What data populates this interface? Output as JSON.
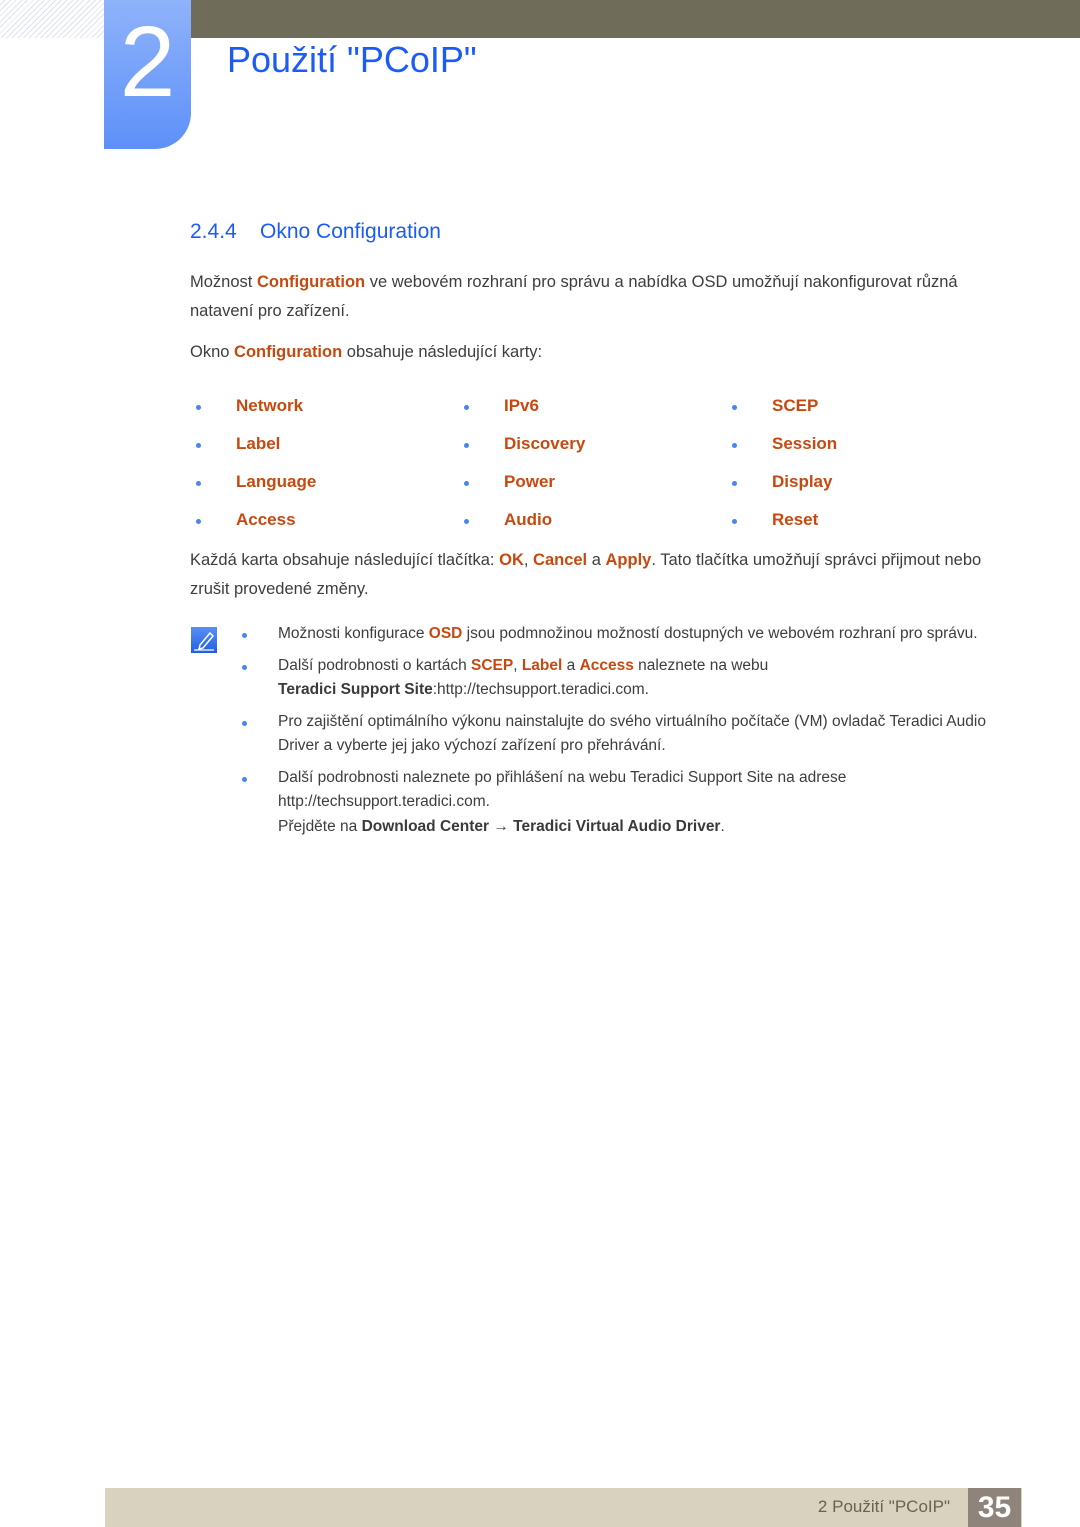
{
  "header": {
    "chapter_number": "2",
    "chapter_title": "Použití \"PCoIP\""
  },
  "section": {
    "number": "2.4.4",
    "title": "Okno Configuration"
  },
  "intro": {
    "p1_pre": "Možnost ",
    "p1_hl": "Configuration",
    "p1_post": " ve webovém rozhraní pro správu a nabídka OSD umožňují nakonfigurovat různá natavení pro zařízení.",
    "p2_pre": "Okno ",
    "p2_hl": "Configuration",
    "p2_post": " obsahuje následující karty:"
  },
  "tabs": [
    [
      "Network",
      "IPv6",
      "SCEP"
    ],
    [
      "Label",
      "Discovery",
      "Session"
    ],
    [
      "Language",
      "Power",
      "Display"
    ],
    [
      "Access",
      "Audio",
      "Reset"
    ]
  ],
  "buttons_para": {
    "pre": "Každá karta obsahuje následující tlačítka: ",
    "ok": "OK",
    "sep1": ", ",
    "cancel": "Cancel",
    "sep2": " a ",
    "apply": "Apply",
    "post": ". Tato tlačítka umožňují správci přijmout nebo zrušit provedené změny."
  },
  "notes": {
    "icon": "note-pencil-icon",
    "n1_pre": "Možnosti konfigurace ",
    "n1_hl": "OSD",
    "n1_post": " jsou podmnožinou možností dostupných ve webovém rozhraní pro správu.",
    "n2_pre": "Další podrobnosti o kartách ",
    "n2_hl1": "SCEP",
    "n2_sep1": ", ",
    "n2_hl2": "Label",
    "n2_sep2": " a ",
    "n2_hl3": "Access",
    "n2_post": " naleznete na webu",
    "n2_bold": "Teradici Support Site",
    "n2_url": ":http://techsupport.teradici.com.",
    "n3": "Pro zajištění optimálního výkonu nainstalujte do svého virtuálního počítače (VM) ovladač Teradici Audio Driver a vyberte jej jako výchozí zařízení pro přehrávání.",
    "n4_line1": "Další podrobnosti naleznete po přihlášení na webu Teradici Support Site na adrese",
    "n4_line2": "http://techsupport.teradici.com.",
    "n4_pre": "Přejděte na ",
    "n4_b1": "Download Center",
    "n4_arrow": " → ",
    "n4_b2": "Teradici Virtual Audio Driver",
    "n4_end": "."
  },
  "footer": {
    "label": "2 Použití \"PCoIP\"",
    "page_number": "35"
  }
}
